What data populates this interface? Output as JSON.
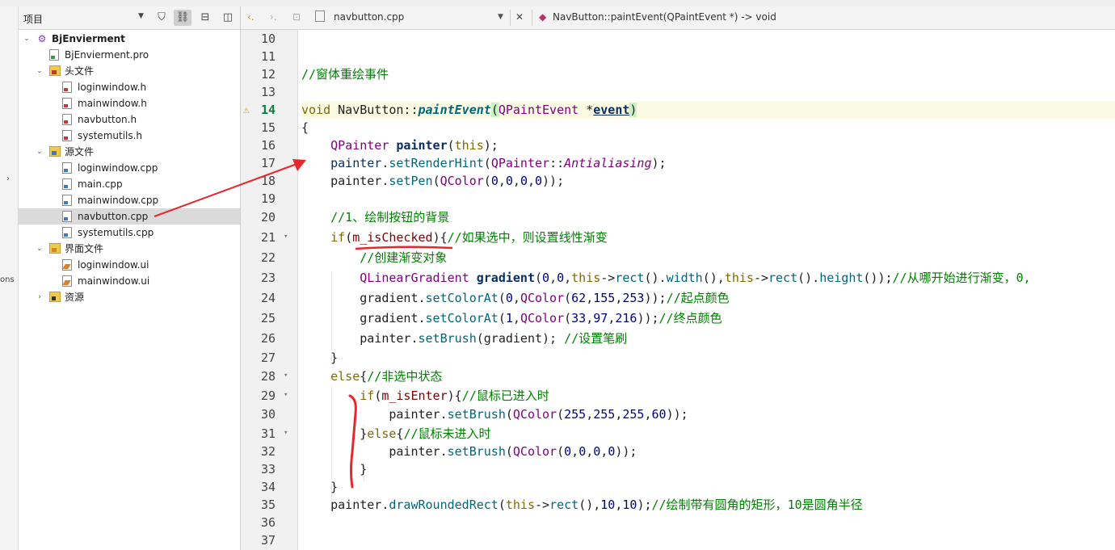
{
  "sidebar": {
    "title": "项目",
    "tree": [
      {
        "label": "BjEnvierment",
        "depth": 0,
        "kind": "project",
        "expanded": true
      },
      {
        "label": "BjEnvierment.pro",
        "depth": 1,
        "kind": "pro"
      },
      {
        "label": "头文件",
        "depth": 1,
        "kind": "folder-h",
        "expanded": true
      },
      {
        "label": "loginwindow.h",
        "depth": 2,
        "kind": "h"
      },
      {
        "label": "mainwindow.h",
        "depth": 2,
        "kind": "h"
      },
      {
        "label": "navbutton.h",
        "depth": 2,
        "kind": "h"
      },
      {
        "label": "systemutils.h",
        "depth": 2,
        "kind": "h"
      },
      {
        "label": "源文件",
        "depth": 1,
        "kind": "folder-cpp",
        "expanded": true
      },
      {
        "label": "loginwindow.cpp",
        "depth": 2,
        "kind": "cpp"
      },
      {
        "label": "main.cpp",
        "depth": 2,
        "kind": "cpp"
      },
      {
        "label": "mainwindow.cpp",
        "depth": 2,
        "kind": "cpp"
      },
      {
        "label": "navbutton.cpp",
        "depth": 2,
        "kind": "cpp",
        "selected": true
      },
      {
        "label": "systemutils.cpp",
        "depth": 2,
        "kind": "cpp"
      },
      {
        "label": "界面文件",
        "depth": 1,
        "kind": "folder-ui",
        "expanded": true
      },
      {
        "label": "loginwindow.ui",
        "depth": 2,
        "kind": "ui"
      },
      {
        "label": "mainwindow.ui",
        "depth": 2,
        "kind": "ui"
      },
      {
        "label": "资源",
        "depth": 1,
        "kind": "folder-res",
        "expanded": false
      }
    ]
  },
  "leftstrip": {
    "text": "ons"
  },
  "editor": {
    "file_tab": "navbutton.cpp",
    "symbol": "NavButton::paintEvent(QPaintEvent *) -> void"
  },
  "lines": [
    {
      "n": "10",
      "html": ""
    },
    {
      "n": "11",
      "html": ""
    },
    {
      "n": "12",
      "html": "<span class='cm'>//窗体重绘事件</span>"
    },
    {
      "n": "13",
      "html": ""
    },
    {
      "n": "14",
      "warn": true,
      "hl": true,
      "html": "<span class='kw'>void</span> NavButton::<span class='em'>paintEvent</span><span class='pr'>(</span><span class='ty'>QPaintEvent</span> *<span class='pm'>event</span><span class='pr'>)</span>"
    },
    {
      "n": "15",
      "html": "{"
    },
    {
      "n": "16",
      "html": "    <span class='ty'>QPainter</span> <span class='bd'>painter</span>(<span class='kw'>this</span>);"
    },
    {
      "n": "17",
      "html": "    <span class='bd' style='font-weight:normal'>painter</span>.<span class='fn'>setRenderHint</span>(<span class='ty'>QPainter</span>::<span class='en'>Antialiasing</span>);"
    },
    {
      "n": "18",
      "html": "    painter.<span class='fn'>setPen</span>(<span class='ty'>QColor</span>(<span class='nm'>0</span>,<span class='nm'>0</span>,<span class='nm'>0</span>,<span class='nm'>0</span>));"
    },
    {
      "n": "19",
      "html": ""
    },
    {
      "n": "20",
      "html": "    <span class='cm'>//1、绘制按钮的背景</span>"
    },
    {
      "n": "21",
      "fold": true,
      "html": "    <span class='kw'>if</span>(<span class='mem'>m_isChecked</span>){<span class='cm'>//如果选中，则设置线性渐变</span>"
    },
    {
      "n": "22",
      "html": "        <span class='cm'>//创建渐变对象</span>"
    },
    {
      "n": "23",
      "html": "        <span class='ty'>QLinearGradient</span> <span class='bd'>gradient</span>(<span class='nm'>0</span>,<span class='nm'>0</span>,<span class='kw'>this</span>-&gt;<span class='fn'>rect</span>().<span class='fn'>width</span>(),<span class='kw'>this</span>-&gt;<span class='fn'>rect</span>().<span class='fn'>height</span>());<span class='cm'>//从哪开始进行渐变，0,</span>"
    },
    {
      "n": "24",
      "html": "        gradient.<span class='fn'>setColorAt</span>(<span class='nm'>0</span>,<span class='ty'>QColor</span>(<span class='nm'>62</span>,<span class='nm'>155</span>,<span class='nm'>253</span>));<span class='cm'>//起点颜色</span>"
    },
    {
      "n": "25",
      "html": "        gradient.<span class='fn'>setColorAt</span>(<span class='nm'>1</span>,<span class='ty'>QColor</span>(<span class='nm'>33</span>,<span class='nm'>97</span>,<span class='nm'>216</span>));<span class='cm'>//终点颜色</span>"
    },
    {
      "n": "26",
      "html": "        painter.<span class='fn'>setBrush</span>(gradient); <span class='cm'>//设置笔刷</span>"
    },
    {
      "n": "27",
      "html": "    }"
    },
    {
      "n": "28",
      "fold": true,
      "html": "    <span class='kw'>else</span>{<span class='cm'>//非选中状态</span>"
    },
    {
      "n": "29",
      "fold": true,
      "html": "        <span class='kw'>if</span>(<span class='mem'>m_isEnter</span>){<span class='cm'>//鼠标已进入时</span>"
    },
    {
      "n": "30",
      "html": "            painter.<span class='fn'>setBrush</span>(<span class='ty'>QColor</span>(<span class='nm'>255</span>,<span class='nm'>255</span>,<span class='nm'>255</span>,<span class='nm'>60</span>));"
    },
    {
      "n": "31",
      "fold": true,
      "html": "        }<span class='kw'>else</span>{<span class='cm'>//鼠标未进入时</span>"
    },
    {
      "n": "32",
      "html": "            painter.<span class='fn'>setBrush</span>(<span class='ty'>QColor</span>(<span class='nm'>0</span>,<span class='nm'>0</span>,<span class='nm'>0</span>,<span class='nm'>0</span>));"
    },
    {
      "n": "33",
      "html": "        }"
    },
    {
      "n": "34",
      "html": "    }"
    },
    {
      "n": "35",
      "html": "    painter.<span class='fn'>drawRoundedRect</span>(<span class='kw'>this</span>-&gt;<span class='fn'>rect</span>(),<span class='nm'>10</span>,<span class='nm'>10</span>);<span class='cm'>//绘制带有圆角的矩形，10是圆角半径</span>"
    },
    {
      "n": "36",
      "html": ""
    },
    {
      "n": "37",
      "html": ""
    }
  ],
  "colors": {
    "annotation": "#e8262b",
    "keyword": "#7f6a00",
    "type": "#800080",
    "comment": "#008000"
  }
}
